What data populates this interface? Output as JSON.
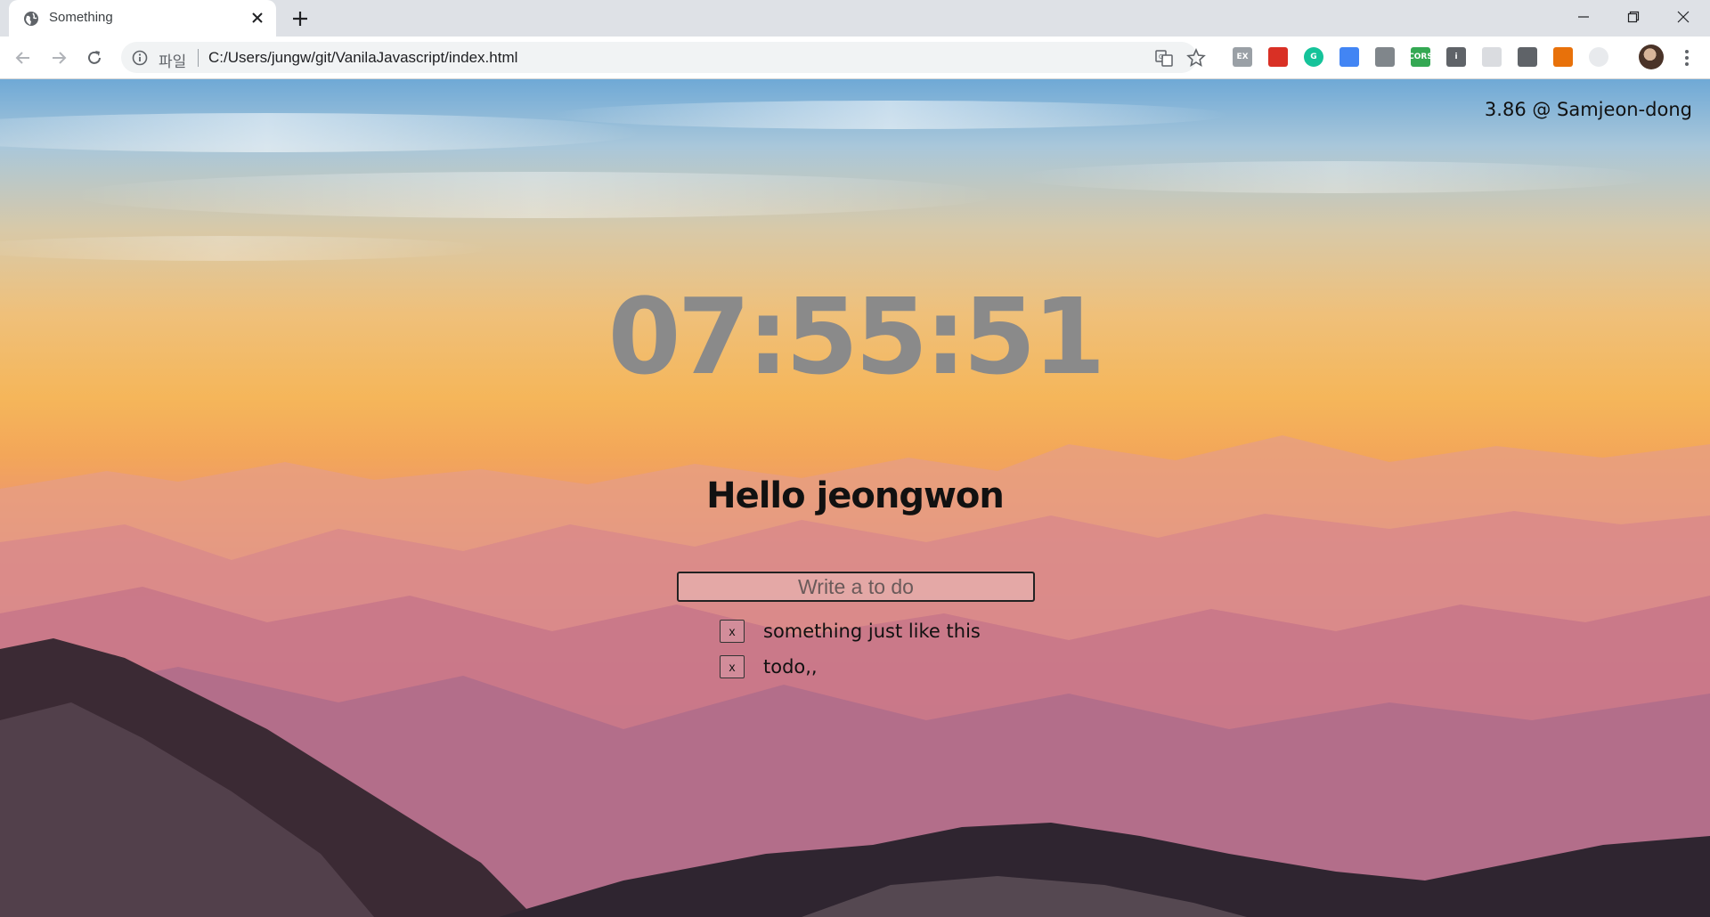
{
  "browser": {
    "tab_title": "Something",
    "scheme_label": "파일",
    "url": "C:/Users/jungw/git/VanilaJavascript/index.html",
    "extensions": [
      {
        "icon": "ex-extension-icon",
        "color": "#9aa0a6",
        "label": "EX"
      },
      {
        "icon": "red-book-extension-icon",
        "color": "#d93025",
        "label": ""
      },
      {
        "icon": "grammarly-extension-icon",
        "color": "#15c39a",
        "label": "G"
      },
      {
        "icon": "color-circles-extension-icon",
        "color": "#4285f4",
        "label": ""
      },
      {
        "icon": "highlighter-extension-icon",
        "color": "#80868b",
        "label": ""
      },
      {
        "icon": "cors-extension-icon",
        "color": "#34a853",
        "label": "CORS"
      },
      {
        "icon": "info-extension-icon",
        "color": "#5f6368",
        "label": "i"
      },
      {
        "icon": "blank-extension-icon",
        "color": "#dadce0",
        "label": ""
      },
      {
        "icon": "lightbulb-extension-icon",
        "color": "#5f6368",
        "label": ""
      },
      {
        "icon": "office-extension-icon",
        "color": "#e8710a",
        "label": ""
      },
      {
        "icon": "circle-extension-icon",
        "color": "#e8eaed",
        "label": ""
      }
    ]
  },
  "page": {
    "weather": "3.86 @ Samjeon-dong",
    "clock": "07:55:51",
    "greeting": "Hello jeongwon",
    "todo_placeholder": "Write a to do",
    "delete_label": "x",
    "todos": [
      {
        "text": "something just like this"
      },
      {
        "text": "todo,,"
      }
    ]
  }
}
